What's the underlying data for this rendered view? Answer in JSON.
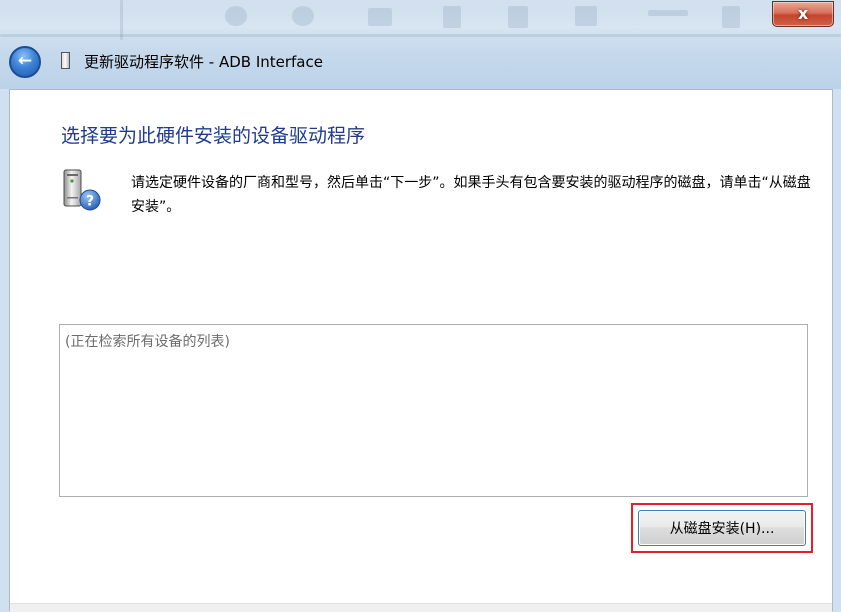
{
  "window": {
    "title": "更新驱动程序软件 - ADB Interface",
    "close_label": "x",
    "back_label": "←"
  },
  "page": {
    "heading": "选择要为此硬件安装的设备驱动程序",
    "instruction": "请选定硬件设备的厂商和型号，然后单击“下一步”。如果手头有包含要安装的驱动程序的磁盘，请单击“从磁盘安装”。"
  },
  "device_list": {
    "status_text": "(正在检索所有设备的列表)"
  },
  "buttons": {
    "have_disk_label": "从磁盘安装(H)..."
  },
  "icons": {
    "back": "back-arrow-icon",
    "close": "close-icon",
    "hardware": "hardware-question-icon",
    "device": "device-icon"
  },
  "colors": {
    "heading": "#1e3b8f",
    "highlight": "#e0202a"
  }
}
